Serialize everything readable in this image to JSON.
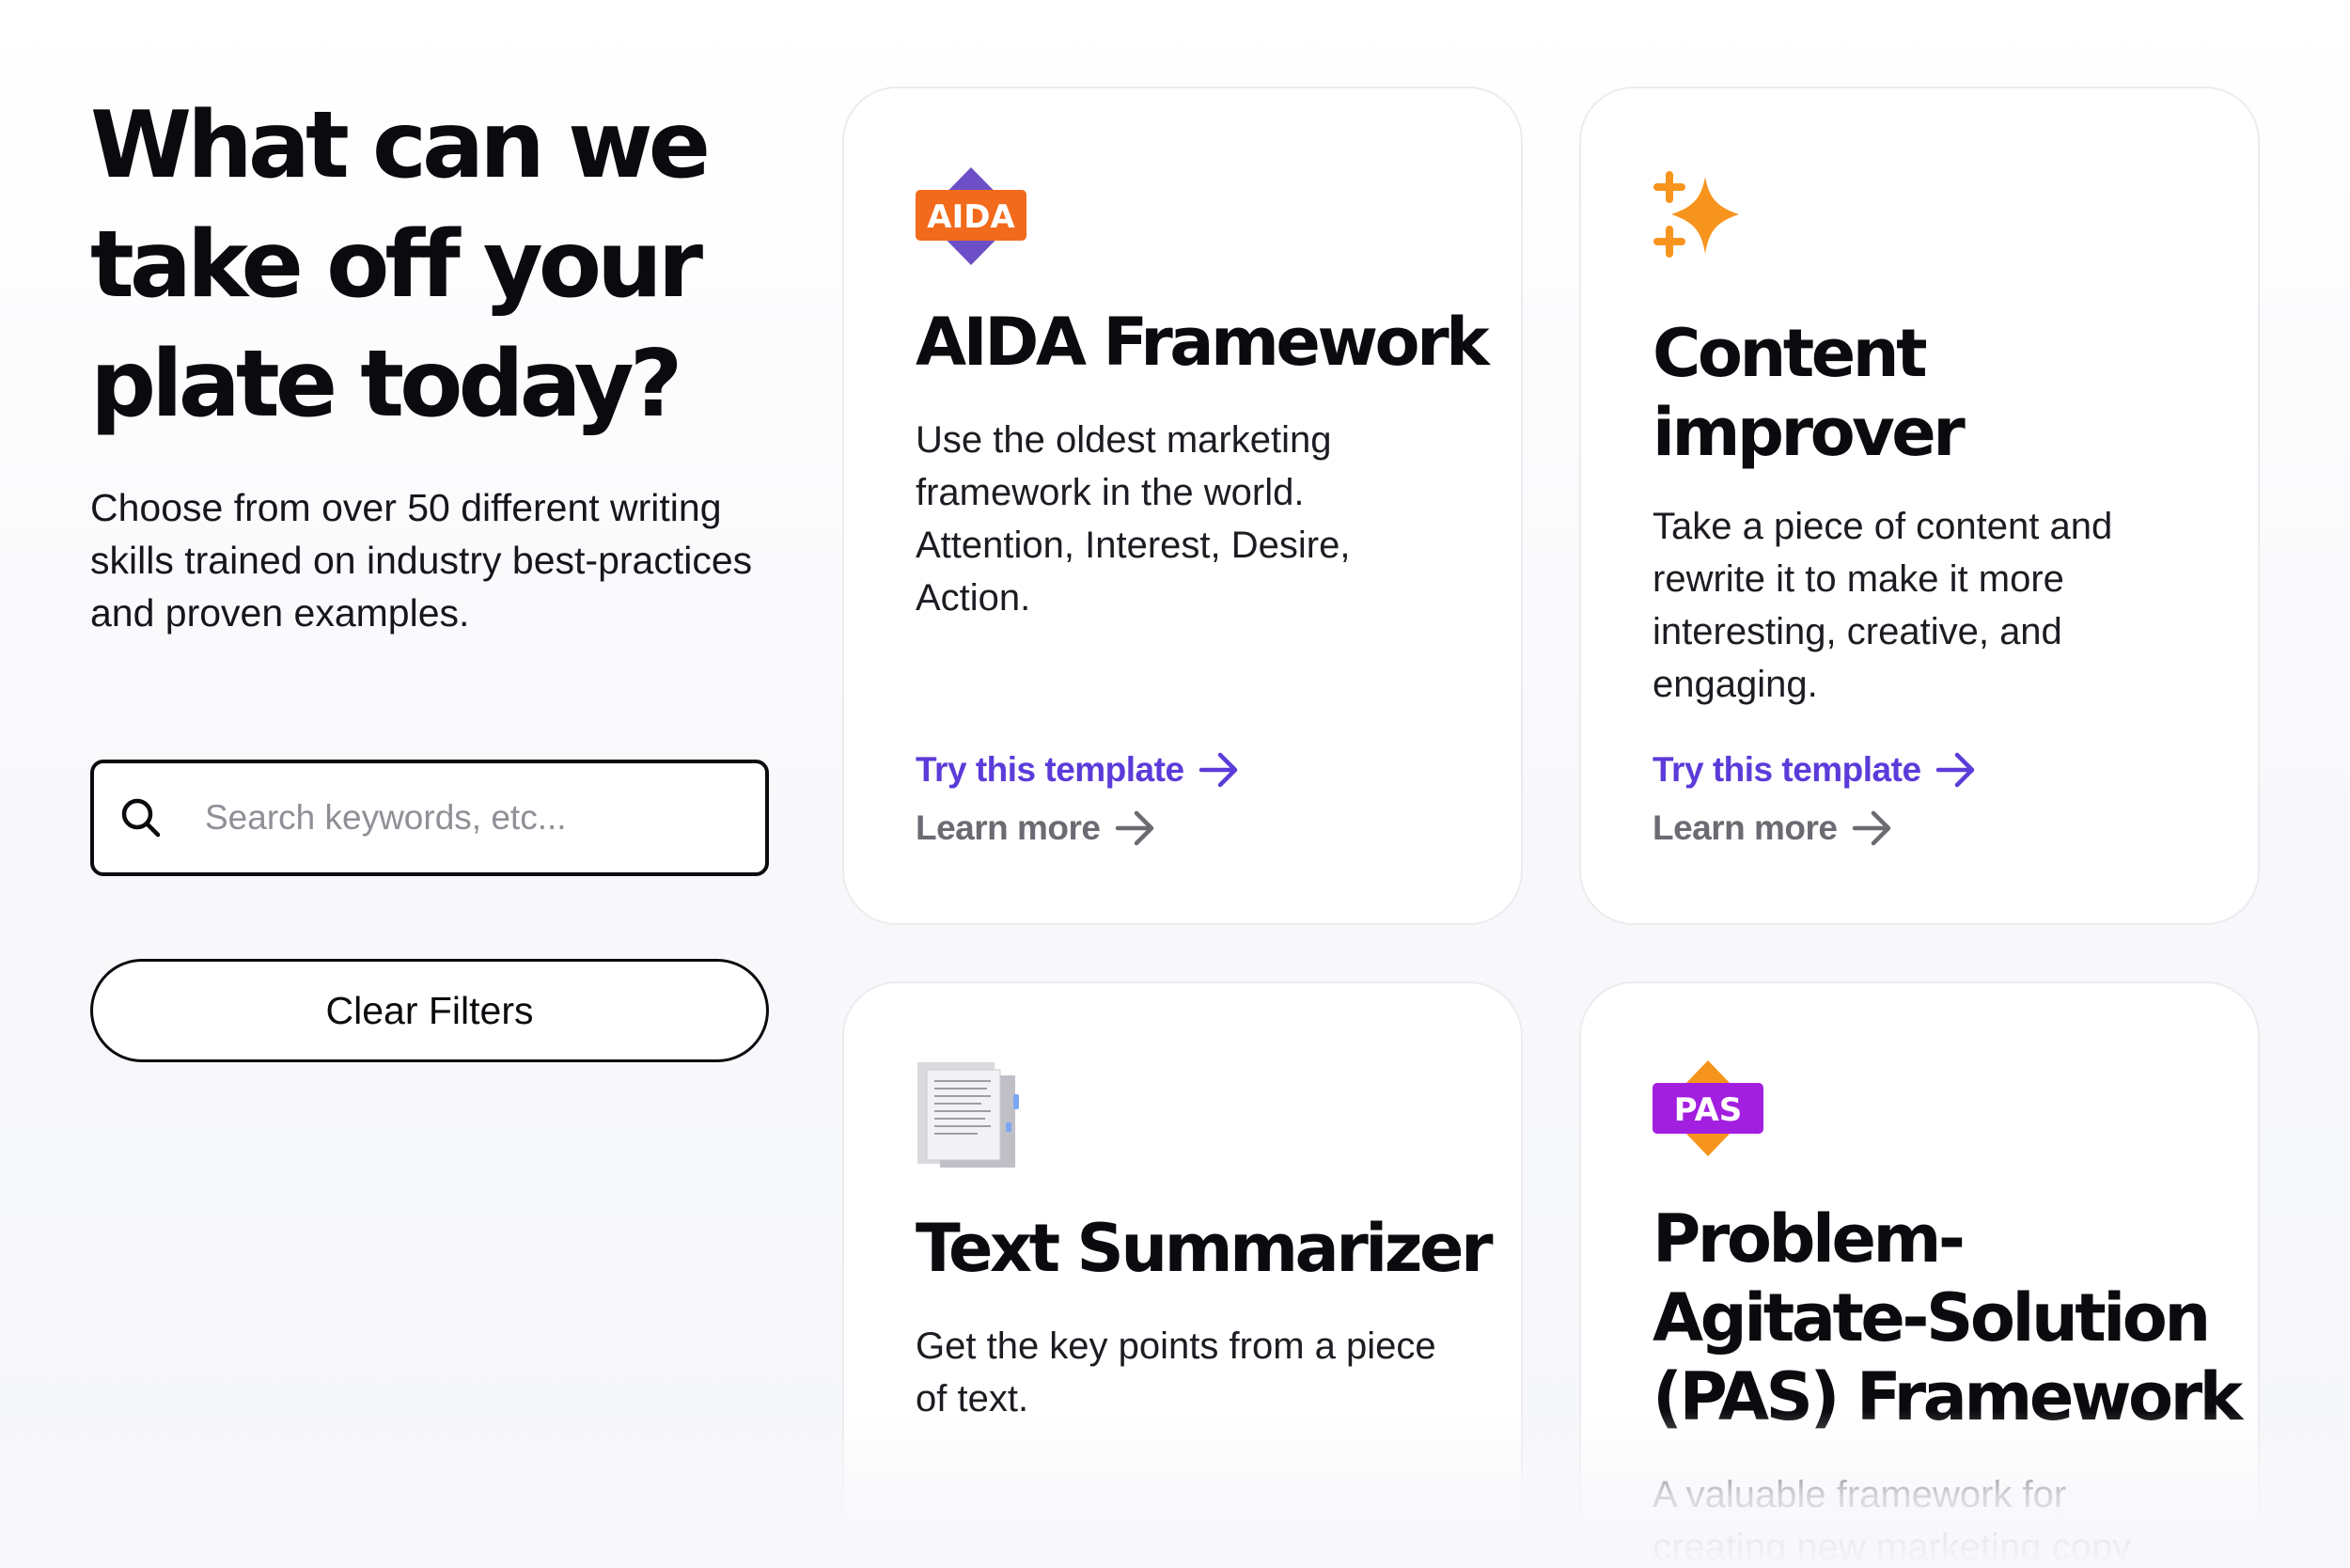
{
  "headline": {
    "line1": "What can we",
    "line2": "take off your",
    "line3": "plate today?"
  },
  "intro": "Choose from over 50 different writing skills trained on industry best-practices and proven examples.",
  "search": {
    "placeholder": "Search keywords, etc...",
    "value": "",
    "icon": "search-icon"
  },
  "clear_filters_label": "Clear Filters",
  "colors": {
    "accent": "#5b3bd9",
    "muted_link": "#6b6b72",
    "aida_badge_orange": "#f26a1b",
    "aida_diamond": "#6c4fc7",
    "sparkle": "#f7941d",
    "pas_badge_purple": "#a21fe0",
    "pas_diamond": "#f7941d"
  },
  "cards": [
    {
      "icon": "aida-badge-icon",
      "badge_text": "AIDA",
      "title_lines": [
        "AIDA Framework"
      ],
      "description": "Use the oldest marketing framework in the world. Attention, Interest, Desire, Action.",
      "try_label": "Try this template",
      "learn_label": "Learn more"
    },
    {
      "icon": "sparkles-icon",
      "title_lines": [
        "Content",
        "improver"
      ],
      "description": "Take a piece of content and rewrite it to make it more interesting, creative, and engaging.",
      "try_label": "Try this template",
      "learn_label": "Learn more"
    },
    {
      "icon": "document-pages-icon",
      "title_lines": [
        "Text Summarizer"
      ],
      "description": "Get the key points from a piece of text."
    },
    {
      "icon": "pas-badge-icon",
      "badge_text": "PAS",
      "title_lines": [
        "Problem-",
        "Agitate-Solution",
        "(PAS) Framework"
      ],
      "description": "A valuable framework for creating new marketing copy"
    }
  ]
}
